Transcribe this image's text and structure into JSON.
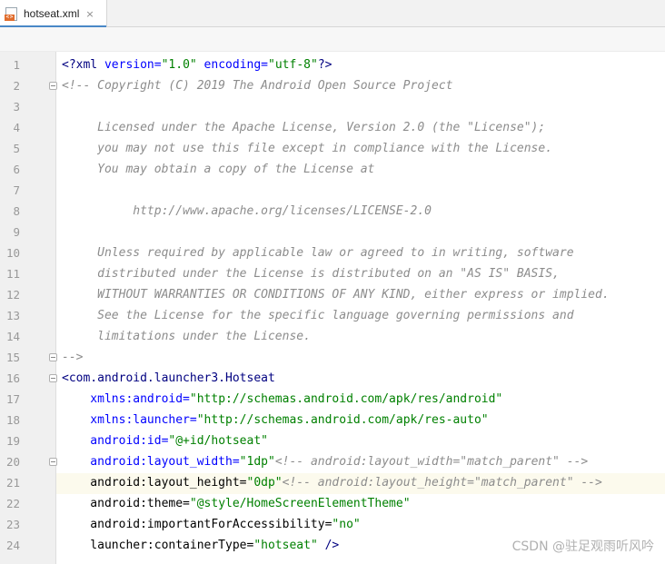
{
  "tab": {
    "filename": "hotseat.xml",
    "file_icon": "xml-file-icon",
    "close_glyph": "×"
  },
  "line_numbers": [
    "1",
    "2",
    "3",
    "4",
    "5",
    "6",
    "7",
    "8",
    "9",
    "10",
    "11",
    "12",
    "13",
    "14",
    "15",
    "16",
    "17",
    "18",
    "19",
    "20",
    "21",
    "22",
    "23",
    "24"
  ],
  "code": {
    "l1": {
      "pi": "<?xml",
      "a1": " version=",
      "v1": "\"1.0\"",
      "a2": " encoding=",
      "v2": "\"utf-8\"",
      "end": "?>"
    },
    "l2": "<!-- Copyright (C) 2019 The Android Open Source Project",
    "l4": "     Licensed under the Apache License, Version 2.0 (the \"License\");",
    "l5": "     you may not use this file except in compliance with the License.",
    "l6": "     You may obtain a copy of the License at",
    "l8": "          http://www.apache.org/licenses/LICENSE-2.0",
    "l10": "     Unless required by applicable law or agreed to in writing, software",
    "l11": "     distributed under the License is distributed on an \"AS IS\" BASIS,",
    "l12": "     WITHOUT WARRANTIES OR CONDITIONS OF ANY KIND, either express or implied.",
    "l13": "     See the License for the specific language governing permissions and",
    "l14": "     limitations under the License.",
    "l15": "-->",
    "l16": "<com.android.launcher3.Hotseat",
    "l17": {
      "attr": "    xmlns:android=",
      "val": "\"http://schemas.android.com/apk/res/android\""
    },
    "l18": {
      "attr": "    xmlns:launcher=",
      "val": "\"http://schemas.android.com/apk/res-auto\""
    },
    "l19": {
      "attr": "    android:id=",
      "val": "\"@+id/hotseat\""
    },
    "l20": {
      "attr": "    android:layout_width=",
      "val": "\"1dp\"",
      "comment": "<!-- android:layout_width=\"match_parent\" -->"
    },
    "l21": {
      "attr": "    android:layout_height=",
      "val": "\"0dp\"",
      "comment": "<!-- android:layout_height=\"match_parent\" -->"
    },
    "l22": {
      "attr": "    android:theme=",
      "val": "\"@style/HomeScreenElementTheme\""
    },
    "l23": {
      "attr": "    android:importantForAccessibility=",
      "val": "\"no\""
    },
    "l24": {
      "attr": "    launcher:containerType=",
      "val": "\"hotseat\"",
      "end": " />"
    }
  },
  "watermark": "CSDN @驻足观雨听风吟",
  "colors": {
    "comment": "#8c8c8c",
    "tag": "#000080",
    "attribute": "#0000ff",
    "value": "#008000",
    "current_line": "#fcfaed",
    "tab_accent": "#4a88c7"
  }
}
